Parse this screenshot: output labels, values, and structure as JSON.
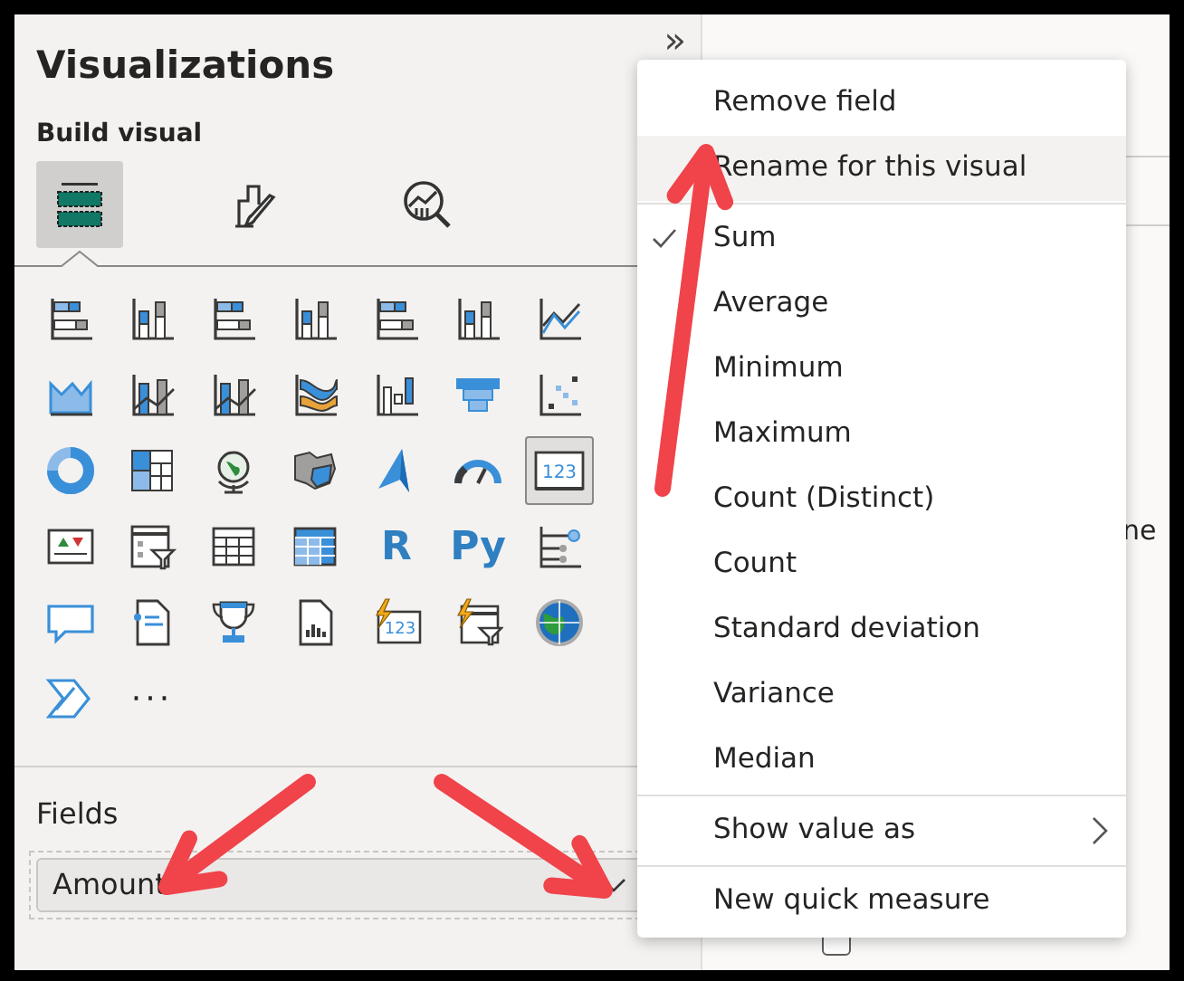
{
  "visualizations": {
    "title": "Visualizations",
    "collapse_glyph": "»",
    "section": "Build visual",
    "tabs": [
      {
        "kind": "fields",
        "selected": true
      },
      {
        "kind": "format",
        "selected": false
      },
      {
        "kind": "analytics",
        "selected": false
      }
    ],
    "visuals": [
      {
        "kind": "hbar",
        "selected": false
      },
      {
        "kind": "vbar",
        "selected": false
      },
      {
        "kind": "hbar",
        "selected": false
      },
      {
        "kind": "vbar",
        "selected": false
      },
      {
        "kind": "hbar",
        "selected": false
      },
      {
        "kind": "vbar",
        "selected": false
      },
      {
        "kind": "line",
        "selected": false
      },
      {
        "kind": "area",
        "selected": false
      },
      {
        "kind": "combo",
        "selected": false
      },
      {
        "kind": "combo",
        "selected": false
      },
      {
        "kind": "ribbon",
        "selected": false
      },
      {
        "kind": "waterfall",
        "selected": false
      },
      {
        "kind": "funnel",
        "selected": false
      },
      {
        "kind": "scatter",
        "selected": false
      },
      {
        "kind": "donut",
        "selected": false
      },
      {
        "kind": "treemap",
        "selected": false
      },
      {
        "kind": "globe",
        "selected": false
      },
      {
        "kind": "map",
        "selected": false
      },
      {
        "kind": "nav",
        "selected": false
      },
      {
        "kind": "gauge",
        "selected": false
      },
      {
        "kind": "card",
        "text": "123",
        "selected": true
      },
      {
        "kind": "kpi",
        "selected": false
      },
      {
        "kind": "slicer",
        "selected": false
      },
      {
        "kind": "table",
        "selected": false
      },
      {
        "kind": "matrix",
        "selected": false
      },
      {
        "kind": "letters",
        "text": "R",
        "selected": false
      },
      {
        "kind": "letters",
        "text": "Py",
        "selected": false
      },
      {
        "kind": "decomp",
        "selected": false
      },
      {
        "kind": "speech",
        "selected": false
      },
      {
        "kind": "narrative",
        "selected": false
      },
      {
        "kind": "trophy",
        "selected": false
      },
      {
        "kind": "report",
        "selected": false
      },
      {
        "kind": "flashcard",
        "text": "123",
        "selected": false
      },
      {
        "kind": "flashslicer",
        "selected": false
      },
      {
        "kind": "worldmap",
        "selected": false
      },
      {
        "kind": "automate",
        "selected": false
      },
      {
        "kind": "more",
        "text": "···",
        "selected": false
      }
    ],
    "fields_label": "Fields",
    "field": {
      "value": "Amount"
    }
  },
  "data_pane": {
    "fragment": "ne",
    "rows": [
      {
        "checked": false
      }
    ]
  },
  "context_menu": {
    "items": [
      {
        "kind": "item",
        "label": "Remove field",
        "checked": false,
        "hovered": false
      },
      {
        "kind": "item",
        "label": "Rename for this visual",
        "checked": false,
        "hovered": true
      },
      {
        "kind": "separator"
      },
      {
        "kind": "item",
        "label": "Sum",
        "checked": true,
        "hovered": false
      },
      {
        "kind": "item",
        "label": "Average",
        "checked": false,
        "hovered": false
      },
      {
        "kind": "item",
        "label": "Minimum",
        "checked": false,
        "hovered": false
      },
      {
        "kind": "item",
        "label": "Maximum",
        "checked": false,
        "hovered": false
      },
      {
        "kind": "item",
        "label": "Count (Distinct)",
        "checked": false,
        "hovered": false
      },
      {
        "kind": "item",
        "label": "Count",
        "checked": false,
        "hovered": false
      },
      {
        "kind": "item",
        "label": "Standard deviation",
        "checked": false,
        "hovered": false
      },
      {
        "kind": "item",
        "label": "Variance",
        "checked": false,
        "hovered": false
      },
      {
        "kind": "item",
        "label": "Median",
        "checked": false,
        "hovered": false
      },
      {
        "kind": "separator"
      },
      {
        "kind": "submenu",
        "label": "Show value as",
        "checked": false,
        "hovered": false
      },
      {
        "kind": "separator"
      },
      {
        "kind": "item",
        "label": "New quick measure",
        "checked": false,
        "hovered": false
      }
    ]
  }
}
